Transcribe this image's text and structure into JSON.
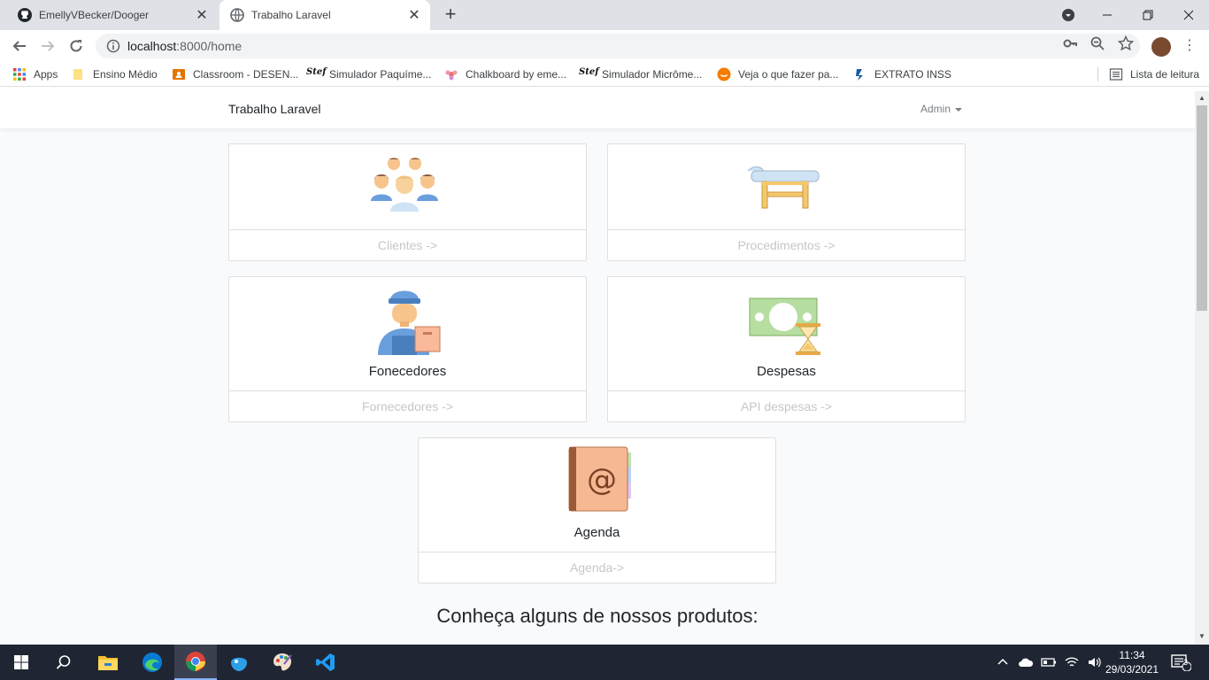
{
  "browser": {
    "tabs": [
      {
        "title": "EmellyVBecker/Dooger"
      },
      {
        "title": "Trabalho Laravel"
      }
    ],
    "url_host": "localhost",
    "url_path": ":8000/home",
    "bookmarks": [
      {
        "label": "Apps",
        "icon": "apps-grid-icon"
      },
      {
        "label": "Ensino Médio",
        "icon": "folder-icon"
      },
      {
        "label": "Classroom - DESEN...",
        "icon": "classroom-icon"
      },
      {
        "label": "Simulador Paquíme...",
        "icon": "stef-icon"
      },
      {
        "label": "Chalkboard by eme...",
        "icon": "chalkboard-icon"
      },
      {
        "label": "Simulador Micrôme...",
        "icon": "stef-icon"
      },
      {
        "label": "Veja o que fazer pa...",
        "icon": "smile-icon"
      },
      {
        "label": "EXTRATO INSS",
        "icon": "dataprev-icon"
      }
    ],
    "reading_list": "Lista de leitura",
    "stef_glyph": "Stef"
  },
  "page": {
    "brand": "Trabalho Laravel",
    "user_menu": "Admin",
    "cards": [
      {
        "title": "",
        "link": "Clientes ->",
        "icon": "people-group-icon"
      },
      {
        "title": "",
        "link": "Procedimentos ->",
        "icon": "massage-table-icon"
      },
      {
        "title": "Fonecedores",
        "link": "Fornecedores ->",
        "icon": "delivery-man-icon"
      },
      {
        "title": "Despesas",
        "link": "API despesas ->",
        "icon": "money-hourglass-icon"
      },
      {
        "title": "Agenda",
        "link": "Agenda->",
        "icon": "address-book-icon"
      }
    ],
    "products_heading": "Conheça alguns de nossos produtos:"
  },
  "taskbar": {
    "time": "11:34",
    "date": "29/03/2021",
    "notifications": "3"
  },
  "colors": {
    "tabstrip": "#dee1e6",
    "page_bg": "#f8fafc",
    "taskbar": "#1f2533",
    "link_muted": "#c5c7c9"
  }
}
